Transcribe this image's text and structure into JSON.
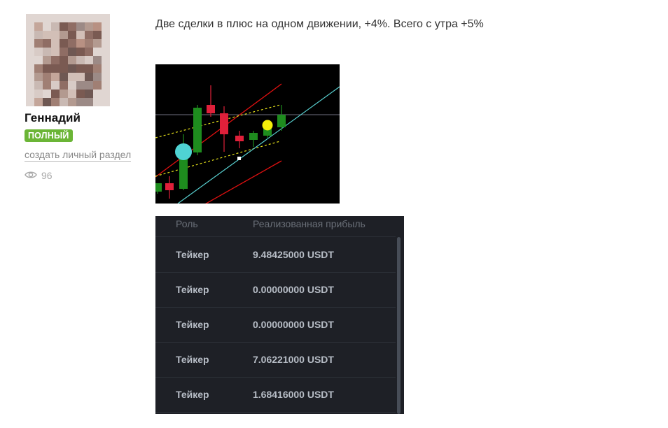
{
  "author": {
    "name": "Геннадий",
    "badge": "ПОЛНЫЙ",
    "create_section_link": "создать личный раздел",
    "views_count": "96",
    "views_icon": "eye-icon",
    "badge_color": "#6bb536"
  },
  "post": {
    "text": "Две сделки в плюс на одном движении, +4%. Всего с утра +5%"
  },
  "chart_image": {
    "background": "#000000",
    "bull_color": "#1e8c1e",
    "bear_color": "#e0203a",
    "channel_color": "#e01010",
    "inner_channel_color": "#e6e21a",
    "trend_color": "#58d0d0",
    "markers": [
      "cyan-circle",
      "yellow-circle"
    ]
  },
  "trades_table": {
    "headers": {
      "role": "Роль",
      "profit": "Реализованная прибыль"
    },
    "rows": [
      {
        "role": "Тейкер",
        "profit": "9.48425000 USDT"
      },
      {
        "role": "Тейкер",
        "profit": "0.00000000 USDT"
      },
      {
        "role": "Тейкер",
        "profit": "0.00000000 USDT"
      },
      {
        "role": "Тейкер",
        "profit": "7.06221000 USDT"
      },
      {
        "role": "Тейкер",
        "profit": "1.68416000 USDT"
      }
    ]
  }
}
